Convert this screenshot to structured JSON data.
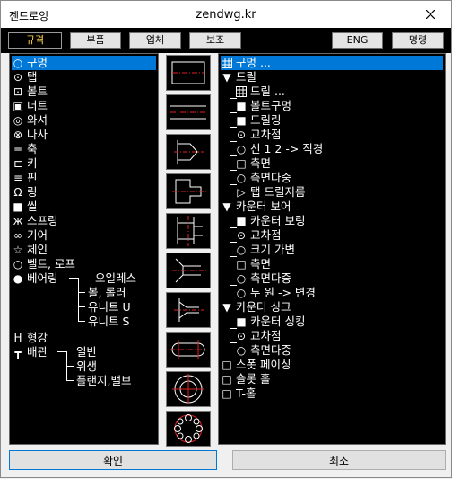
{
  "window": {
    "app_title": "젠드로잉",
    "center_title": "zendwg.kr"
  },
  "toolbar": {
    "buttons": [
      {
        "label": "규격",
        "active": true
      },
      {
        "label": "부품"
      },
      {
        "label": "업체"
      },
      {
        "label": "보조"
      },
      {
        "label": "ENG"
      },
      {
        "label": "명령"
      }
    ]
  },
  "left_list": {
    "items": [
      {
        "icon": "○",
        "label": "구멍",
        "selected": true
      },
      {
        "icon": "⊙",
        "label": "탭"
      },
      {
        "icon": "⊡",
        "label": "볼트"
      },
      {
        "icon": "▣",
        "label": "너트"
      },
      {
        "icon": "◎",
        "label": "와셔"
      },
      {
        "icon": "⊗",
        "label": "나사"
      },
      {
        "icon": "═",
        "label": "축"
      },
      {
        "icon": "⊏",
        "label": "키"
      },
      {
        "icon": "≡",
        "label": "핀"
      },
      {
        "icon": "Ω",
        "label": "링"
      },
      {
        "icon": "■",
        "label": "씰"
      },
      {
        "icon": "ж",
        "label": "스프링"
      },
      {
        "icon": "∞",
        "label": "기어"
      },
      {
        "icon": "☆",
        "label": "체인"
      },
      {
        "icon": "○",
        "label": "벨트, 로프"
      },
      {
        "icon": "●",
        "label": "베어링"
      },
      {
        "label": "오일레스"
      },
      {
        "label": "볼, 롤러"
      },
      {
        "label": "유니트 U"
      },
      {
        "label": "유니트 S"
      },
      {
        "icon": "H",
        "label": "형강"
      },
      {
        "icon": "┳",
        "label": "배관"
      },
      {
        "label": "일반"
      },
      {
        "label": "위생"
      },
      {
        "label": "플랜지,밸브"
      }
    ]
  },
  "thumbnails": [
    "drill-hole",
    "through-hole",
    "countersink-hole",
    "counterbore-hole",
    "counterbore-step",
    "countersink-step",
    "spot-facing",
    "slot-hole",
    "t-hole",
    "pcd-holes"
  ],
  "tree": {
    "items": [
      {
        "icon": "grid",
        "label": "구멍 ...",
        "selected": true
      },
      {
        "icon": "▼",
        "label": "드릴"
      },
      {
        "icon": "grid",
        "label": "드릴 ..."
      },
      {
        "icon": "■",
        "label": "볼트구멍"
      },
      {
        "icon": "■",
        "label": "드릴링"
      },
      {
        "icon": "⊙",
        "label": "교차점"
      },
      {
        "icon": "○",
        "label": "선 1 2 -> 직경"
      },
      {
        "icon": "□",
        "label": "측면"
      },
      {
        "icon": "○",
        "label": "측면다중"
      },
      {
        "icon": "▷",
        "label": "탭 드릴지름"
      },
      {
        "icon": "▼",
        "label": "카운터 보어"
      },
      {
        "icon": "■",
        "label": "카운터 보링"
      },
      {
        "icon": "⊙",
        "label": "교차점"
      },
      {
        "icon": "○",
        "label": "크기 가변"
      },
      {
        "icon": "□",
        "label": "측면"
      },
      {
        "icon": "○",
        "label": "측면다중"
      },
      {
        "icon": "○",
        "label": "두 원 -> 변경"
      },
      {
        "icon": "▼",
        "label": "카운터 싱크"
      },
      {
        "icon": "■",
        "label": "카운터 싱킹"
      },
      {
        "icon": "⊙",
        "label": "교차점"
      },
      {
        "icon": "○",
        "label": "측면다중"
      },
      {
        "icon": "□",
        "label": "스폿 페이싱"
      },
      {
        "icon": "□",
        "label": "슬롯 홀"
      },
      {
        "icon": "□",
        "label": "T-홀"
      }
    ]
  },
  "footer": {
    "ok_label": "확인",
    "cancel_label": "최소"
  },
  "colors": {
    "selection": "#0078d7",
    "panel": "#000000",
    "active_tab_text": "#ffd84a",
    "accent_red": "#e02020"
  }
}
